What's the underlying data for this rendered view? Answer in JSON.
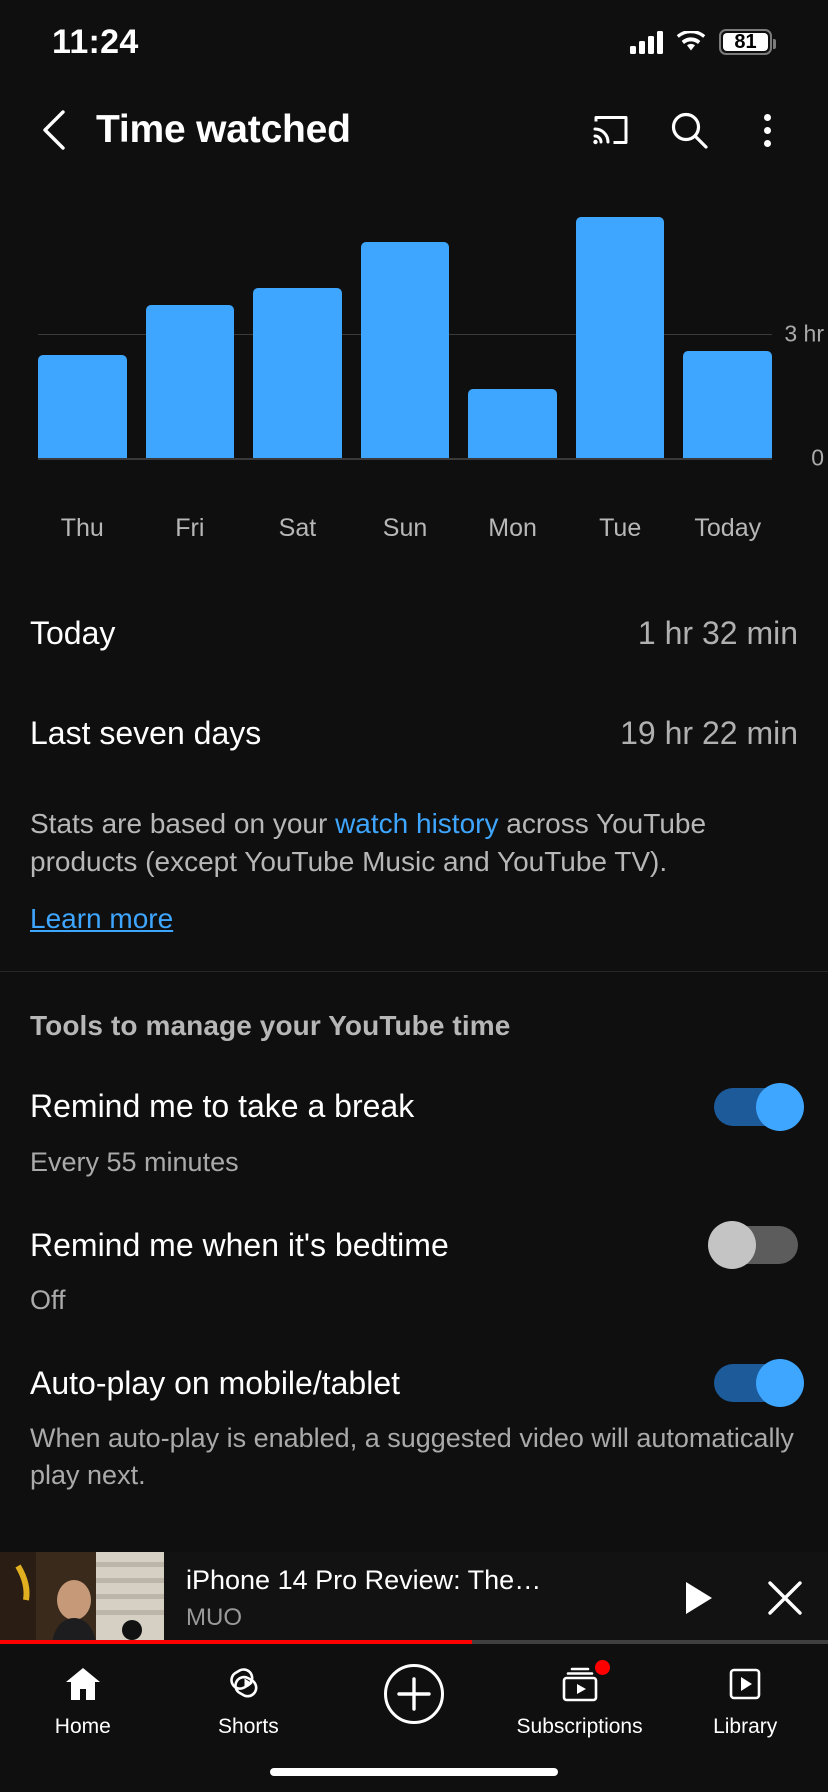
{
  "status_bar": {
    "time": "11:24",
    "battery_percent": "81",
    "icons": {
      "cellular": "signal-bars-icon",
      "wifi": "wifi-icon",
      "battery": "battery-icon"
    }
  },
  "app_bar": {
    "back_label": "back-arrow",
    "title": "Time watched",
    "actions": [
      {
        "name": "cast-icon",
        "label": "Cast"
      },
      {
        "name": "search-icon",
        "label": "Search"
      },
      {
        "name": "more-options-icon",
        "label": "More options"
      }
    ]
  },
  "chart_data": {
    "type": "bar",
    "title": "Time watched",
    "categories": [
      "Thu",
      "Fri",
      "Sat",
      "Sun",
      "Mon",
      "Tue",
      "Today"
    ],
    "values": [
      2.5,
      3.7,
      4.1,
      5.2,
      1.7,
      5.8,
      2.6
    ],
    "unit": "hours",
    "xlabel": "",
    "ylabel": "",
    "ylim": [
      0,
      6.2
    ],
    "gridlines": [
      {
        "value": 3,
        "label": "3 hr"
      }
    ],
    "axis_tick_labels": {
      "top": "3 hr",
      "bottom": "0"
    },
    "bar_color": "#3ea6ff",
    "grid": true,
    "legend": "none"
  },
  "stats": [
    {
      "label": "Today",
      "value": "1 hr 32 min"
    },
    {
      "label": "Last seven days",
      "value": "19 hr 22 min"
    }
  ],
  "description": {
    "part1": "Stats are based on your ",
    "link": "watch history",
    "part2": " across YouTube products (except YouTube Music and YouTube TV).",
    "learn_more": "Learn more"
  },
  "tools": {
    "heading": "Tools to manage your YouTube time",
    "settings": [
      {
        "title": "Remind me to take a break",
        "subtitle": "Every 55 minutes",
        "toggle": "on"
      },
      {
        "title": "Remind me when it's bedtime",
        "subtitle": "Off",
        "toggle": "off"
      },
      {
        "title": "Auto-play on mobile/tablet",
        "subtitle": "When auto-play is enabled, a suggested video will automatically play next.",
        "toggle": "on"
      }
    ]
  },
  "mini_player": {
    "video_title": "iPhone 14 Pro Review: The…",
    "channel": "MUO",
    "play_icon": "play-icon",
    "close_icon": "close-icon",
    "progress_percent": 57
  },
  "bottom_nav": [
    {
      "label": "Home",
      "icon": "home-icon",
      "badge": false
    },
    {
      "label": "Shorts",
      "icon": "shorts-icon",
      "badge": false
    },
    {
      "label": "",
      "icon": "create-plus-icon",
      "badge": false
    },
    {
      "label": "Subscriptions",
      "icon": "subscriptions-icon",
      "badge": true
    },
    {
      "label": "Library",
      "icon": "library-icon",
      "badge": false
    }
  ],
  "colors": {
    "accent": "#3ea6ff",
    "background": "#0f0f0f",
    "progress": "#ff0000"
  }
}
